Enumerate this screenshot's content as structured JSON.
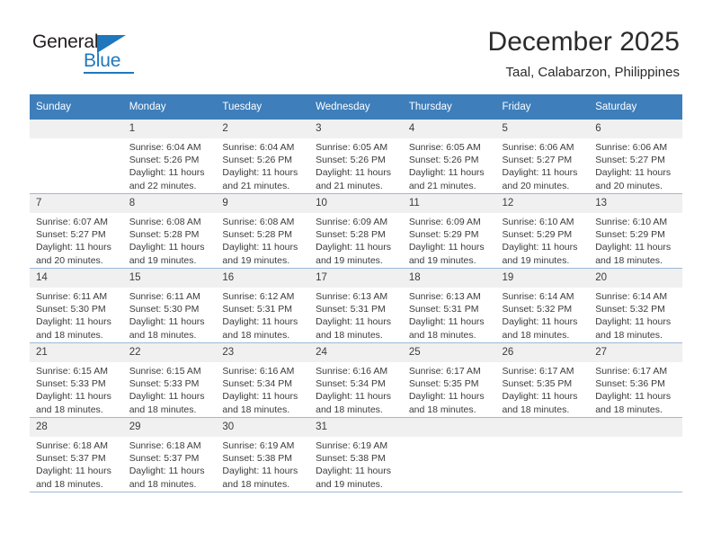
{
  "brand": {
    "name_top": "General",
    "name_bottom": "Blue",
    "accent_color": "#1f77bd"
  },
  "header": {
    "title": "December 2025",
    "subtitle": "Taal, Calabarzon, Philippines"
  },
  "calendar": {
    "header_bg": "#3d7ebb",
    "daynum_bg": "#f0f0f0",
    "weekdays": [
      "Sunday",
      "Monday",
      "Tuesday",
      "Wednesday",
      "Thursday",
      "Friday",
      "Saturday"
    ],
    "weeks": [
      [
        {
          "day": "",
          "sunrise": "",
          "sunset": "",
          "daylight": ""
        },
        {
          "day": "1",
          "sunrise": "Sunrise: 6:04 AM",
          "sunset": "Sunset: 5:26 PM",
          "daylight": "Daylight: 11 hours and 22 minutes."
        },
        {
          "day": "2",
          "sunrise": "Sunrise: 6:04 AM",
          "sunset": "Sunset: 5:26 PM",
          "daylight": "Daylight: 11 hours and 21 minutes."
        },
        {
          "day": "3",
          "sunrise": "Sunrise: 6:05 AM",
          "sunset": "Sunset: 5:26 PM",
          "daylight": "Daylight: 11 hours and 21 minutes."
        },
        {
          "day": "4",
          "sunrise": "Sunrise: 6:05 AM",
          "sunset": "Sunset: 5:26 PM",
          "daylight": "Daylight: 11 hours and 21 minutes."
        },
        {
          "day": "5",
          "sunrise": "Sunrise: 6:06 AM",
          "sunset": "Sunset: 5:27 PM",
          "daylight": "Daylight: 11 hours and 20 minutes."
        },
        {
          "day": "6",
          "sunrise": "Sunrise: 6:06 AM",
          "sunset": "Sunset: 5:27 PM",
          "daylight": "Daylight: 11 hours and 20 minutes."
        }
      ],
      [
        {
          "day": "7",
          "sunrise": "Sunrise: 6:07 AM",
          "sunset": "Sunset: 5:27 PM",
          "daylight": "Daylight: 11 hours and 20 minutes."
        },
        {
          "day": "8",
          "sunrise": "Sunrise: 6:08 AM",
          "sunset": "Sunset: 5:28 PM",
          "daylight": "Daylight: 11 hours and 19 minutes."
        },
        {
          "day": "9",
          "sunrise": "Sunrise: 6:08 AM",
          "sunset": "Sunset: 5:28 PM",
          "daylight": "Daylight: 11 hours and 19 minutes."
        },
        {
          "day": "10",
          "sunrise": "Sunrise: 6:09 AM",
          "sunset": "Sunset: 5:28 PM",
          "daylight": "Daylight: 11 hours and 19 minutes."
        },
        {
          "day": "11",
          "sunrise": "Sunrise: 6:09 AM",
          "sunset": "Sunset: 5:29 PM",
          "daylight": "Daylight: 11 hours and 19 minutes."
        },
        {
          "day": "12",
          "sunrise": "Sunrise: 6:10 AM",
          "sunset": "Sunset: 5:29 PM",
          "daylight": "Daylight: 11 hours and 19 minutes."
        },
        {
          "day": "13",
          "sunrise": "Sunrise: 6:10 AM",
          "sunset": "Sunset: 5:29 PM",
          "daylight": "Daylight: 11 hours and 18 minutes."
        }
      ],
      [
        {
          "day": "14",
          "sunrise": "Sunrise: 6:11 AM",
          "sunset": "Sunset: 5:30 PM",
          "daylight": "Daylight: 11 hours and 18 minutes."
        },
        {
          "day": "15",
          "sunrise": "Sunrise: 6:11 AM",
          "sunset": "Sunset: 5:30 PM",
          "daylight": "Daylight: 11 hours and 18 minutes."
        },
        {
          "day": "16",
          "sunrise": "Sunrise: 6:12 AM",
          "sunset": "Sunset: 5:31 PM",
          "daylight": "Daylight: 11 hours and 18 minutes."
        },
        {
          "day": "17",
          "sunrise": "Sunrise: 6:13 AM",
          "sunset": "Sunset: 5:31 PM",
          "daylight": "Daylight: 11 hours and 18 minutes."
        },
        {
          "day": "18",
          "sunrise": "Sunrise: 6:13 AM",
          "sunset": "Sunset: 5:31 PM",
          "daylight": "Daylight: 11 hours and 18 minutes."
        },
        {
          "day": "19",
          "sunrise": "Sunrise: 6:14 AM",
          "sunset": "Sunset: 5:32 PM",
          "daylight": "Daylight: 11 hours and 18 minutes."
        },
        {
          "day": "20",
          "sunrise": "Sunrise: 6:14 AM",
          "sunset": "Sunset: 5:32 PM",
          "daylight": "Daylight: 11 hours and 18 minutes."
        }
      ],
      [
        {
          "day": "21",
          "sunrise": "Sunrise: 6:15 AM",
          "sunset": "Sunset: 5:33 PM",
          "daylight": "Daylight: 11 hours and 18 minutes."
        },
        {
          "day": "22",
          "sunrise": "Sunrise: 6:15 AM",
          "sunset": "Sunset: 5:33 PM",
          "daylight": "Daylight: 11 hours and 18 minutes."
        },
        {
          "day": "23",
          "sunrise": "Sunrise: 6:16 AM",
          "sunset": "Sunset: 5:34 PM",
          "daylight": "Daylight: 11 hours and 18 minutes."
        },
        {
          "day": "24",
          "sunrise": "Sunrise: 6:16 AM",
          "sunset": "Sunset: 5:34 PM",
          "daylight": "Daylight: 11 hours and 18 minutes."
        },
        {
          "day": "25",
          "sunrise": "Sunrise: 6:17 AM",
          "sunset": "Sunset: 5:35 PM",
          "daylight": "Daylight: 11 hours and 18 minutes."
        },
        {
          "day": "26",
          "sunrise": "Sunrise: 6:17 AM",
          "sunset": "Sunset: 5:35 PM",
          "daylight": "Daylight: 11 hours and 18 minutes."
        },
        {
          "day": "27",
          "sunrise": "Sunrise: 6:17 AM",
          "sunset": "Sunset: 5:36 PM",
          "daylight": "Daylight: 11 hours and 18 minutes."
        }
      ],
      [
        {
          "day": "28",
          "sunrise": "Sunrise: 6:18 AM",
          "sunset": "Sunset: 5:37 PM",
          "daylight": "Daylight: 11 hours and 18 minutes."
        },
        {
          "day": "29",
          "sunrise": "Sunrise: 6:18 AM",
          "sunset": "Sunset: 5:37 PM",
          "daylight": "Daylight: 11 hours and 18 minutes."
        },
        {
          "day": "30",
          "sunrise": "Sunrise: 6:19 AM",
          "sunset": "Sunset: 5:38 PM",
          "daylight": "Daylight: 11 hours and 18 minutes."
        },
        {
          "day": "31",
          "sunrise": "Sunrise: 6:19 AM",
          "sunset": "Sunset: 5:38 PM",
          "daylight": "Daylight: 11 hours and 19 minutes."
        },
        {
          "day": "",
          "sunrise": "",
          "sunset": "",
          "daylight": ""
        },
        {
          "day": "",
          "sunrise": "",
          "sunset": "",
          "daylight": ""
        },
        {
          "day": "",
          "sunrise": "",
          "sunset": "",
          "daylight": ""
        }
      ]
    ]
  }
}
